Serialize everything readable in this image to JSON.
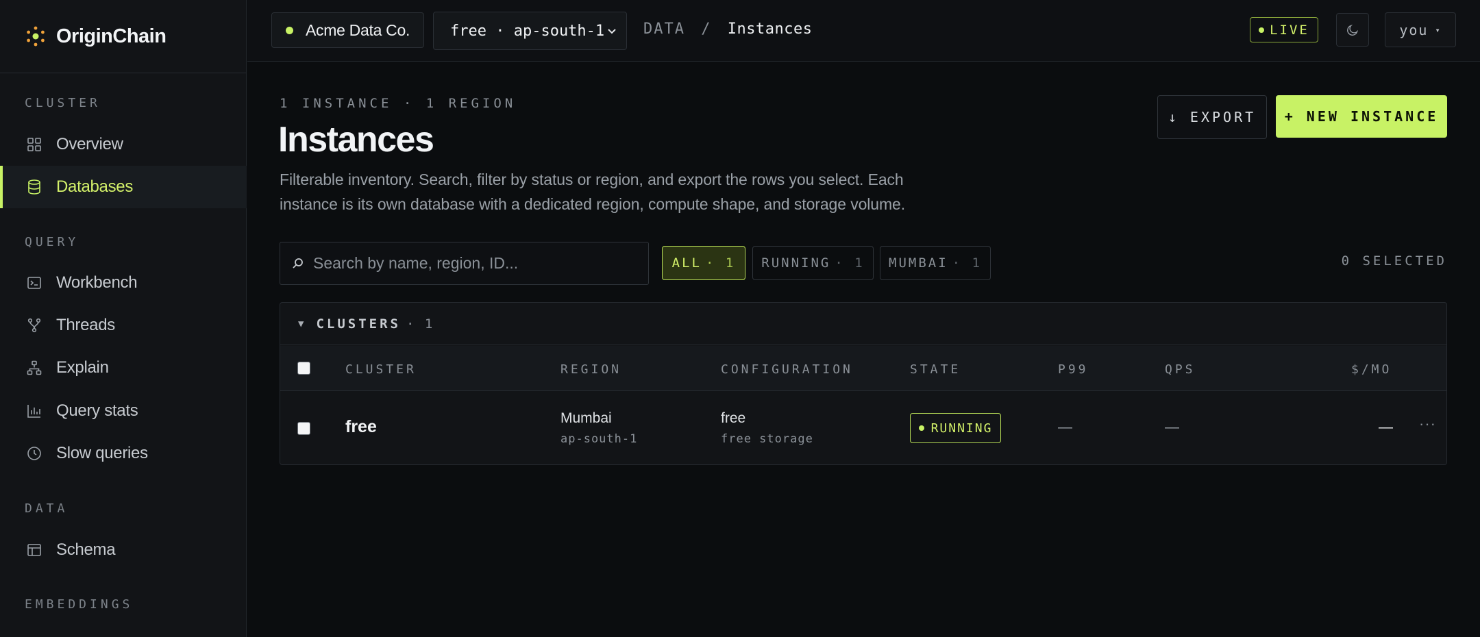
{
  "brand": {
    "name": "OriginChain",
    "accent": "#c8f265"
  },
  "sidebar": {
    "sections": [
      {
        "label": "CLUSTER"
      },
      {
        "label": "QUERY"
      },
      {
        "label": "DATA"
      },
      {
        "label": "EMBEDDINGS"
      }
    ],
    "items": [
      {
        "label": "Overview",
        "icon": "grid-icon",
        "active": false
      },
      {
        "label": "Databases",
        "icon": "database-icon",
        "active": true
      },
      {
        "label": "Workbench",
        "icon": "terminal-icon",
        "active": false
      },
      {
        "label": "Threads",
        "icon": "branch-icon",
        "active": false
      },
      {
        "label": "Explain",
        "icon": "hierarchy-icon",
        "active": false
      },
      {
        "label": "Query stats",
        "icon": "bar-chart-icon",
        "active": false
      },
      {
        "label": "Slow queries",
        "icon": "clock-icon",
        "active": false
      },
      {
        "label": "Schema",
        "icon": "table-icon",
        "active": false
      }
    ]
  },
  "topbar": {
    "org": "Acme Data Co.",
    "env": {
      "selected": "free · ap-south-1"
    },
    "breadcrumb": {
      "root": "DATA",
      "sep": "/",
      "current": "Instances"
    },
    "live": "LIVE",
    "theme_icon": "moon-icon",
    "user": "you"
  },
  "page": {
    "eyebrow": "1 INSTANCE · 1 REGION",
    "title": "Instances",
    "description": "Filterable inventory. Search, filter by status or region, and export the rows you select. Each instance is its own database with a dedicated region, compute shape, and storage volume.",
    "export_label": "↓ EXPORT",
    "new_label": "+ NEW INSTANCE"
  },
  "filters": {
    "search_placeholder": "Search by name, region, ID...",
    "chips": [
      {
        "label": "ALL",
        "count": "· 1",
        "active": true
      },
      {
        "label": "RUNNING",
        "count": "· 1",
        "active": false
      },
      {
        "label": "MUMBAI",
        "count": "· 1",
        "active": false
      }
    ],
    "selected": "0 SELECTED"
  },
  "table": {
    "group": {
      "label": "CLUSTERS",
      "count": "· 1"
    },
    "columns": [
      "CLUSTER",
      "REGION",
      "CONFIGURATION",
      "STATE",
      "P99",
      "QPS",
      "$/MO"
    ],
    "rows": [
      {
        "cluster": "free",
        "region": "Mumbai",
        "region_code": "ap-south-1",
        "config": "free",
        "config_sub": "free storage",
        "state": "RUNNING",
        "p99": "—",
        "qps": "—",
        "cost": "—",
        "more": "···"
      }
    ]
  }
}
